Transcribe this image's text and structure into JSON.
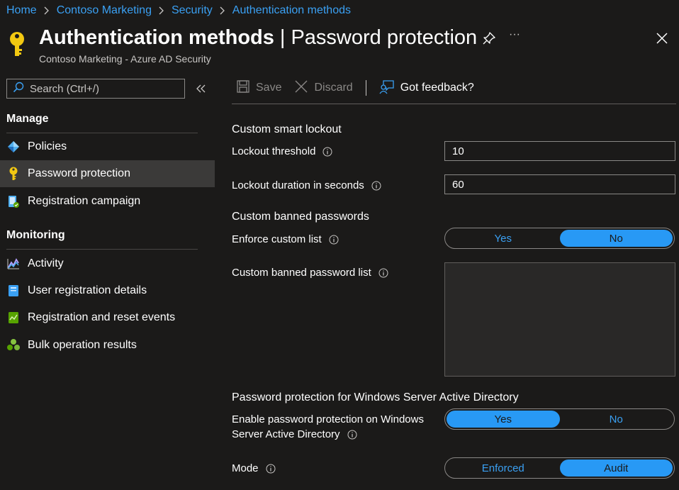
{
  "breadcrumb": [
    "Home",
    "Contoso Marketing",
    "Security",
    "Authentication methods"
  ],
  "header": {
    "title_main": "Authentication methods",
    "title_separator": "|",
    "title_sub": "Password protection",
    "subtitle": "Contoso Marketing - Azure AD Security",
    "more_label": "···"
  },
  "sidebar": {
    "search_placeholder": "Search (Ctrl+/)",
    "sections": [
      {
        "title": "Manage",
        "items": [
          {
            "label": "Policies",
            "icon": "policies-icon"
          },
          {
            "label": "Password protection",
            "icon": "key-icon",
            "active": true
          },
          {
            "label": "Registration campaign",
            "icon": "registration-campaign-icon"
          }
        ]
      },
      {
        "title": "Monitoring",
        "items": [
          {
            "label": "Activity",
            "icon": "activity-chart-icon"
          },
          {
            "label": "User registration details",
            "icon": "user-details-icon"
          },
          {
            "label": "Registration and reset events",
            "icon": "events-icon"
          },
          {
            "label": "Bulk operation results",
            "icon": "bulk-results-icon"
          }
        ]
      }
    ]
  },
  "toolbar": {
    "save_label": "Save",
    "discard_label": "Discard",
    "feedback_label": "Got feedback?"
  },
  "form": {
    "smart_lockout": {
      "title": "Custom smart lockout",
      "threshold_label": "Lockout threshold",
      "threshold_value": "10",
      "duration_label": "Lockout duration in seconds",
      "duration_value": "60"
    },
    "banned_passwords": {
      "title": "Custom banned passwords",
      "enforce_label": "Enforce custom list",
      "enforce_options": [
        "Yes",
        "No"
      ],
      "enforce_selected": "No",
      "list_label": "Custom banned password list",
      "list_value": ""
    },
    "windows_ad": {
      "title": "Password protection for Windows Server Active Directory",
      "enable_label_line1": "Enable password protection on Windows",
      "enable_label_line2": "Server Active Directory",
      "enable_options": [
        "Yes",
        "No"
      ],
      "enable_selected": "Yes",
      "mode_label": "Mode",
      "mode_options": [
        "Enforced",
        "Audit"
      ],
      "mode_selected": "Audit"
    }
  },
  "colors": {
    "background": "#1b1a19",
    "accent": "#2899f5",
    "link": "#3aa0f3",
    "active_nav": "#3b3a39"
  }
}
